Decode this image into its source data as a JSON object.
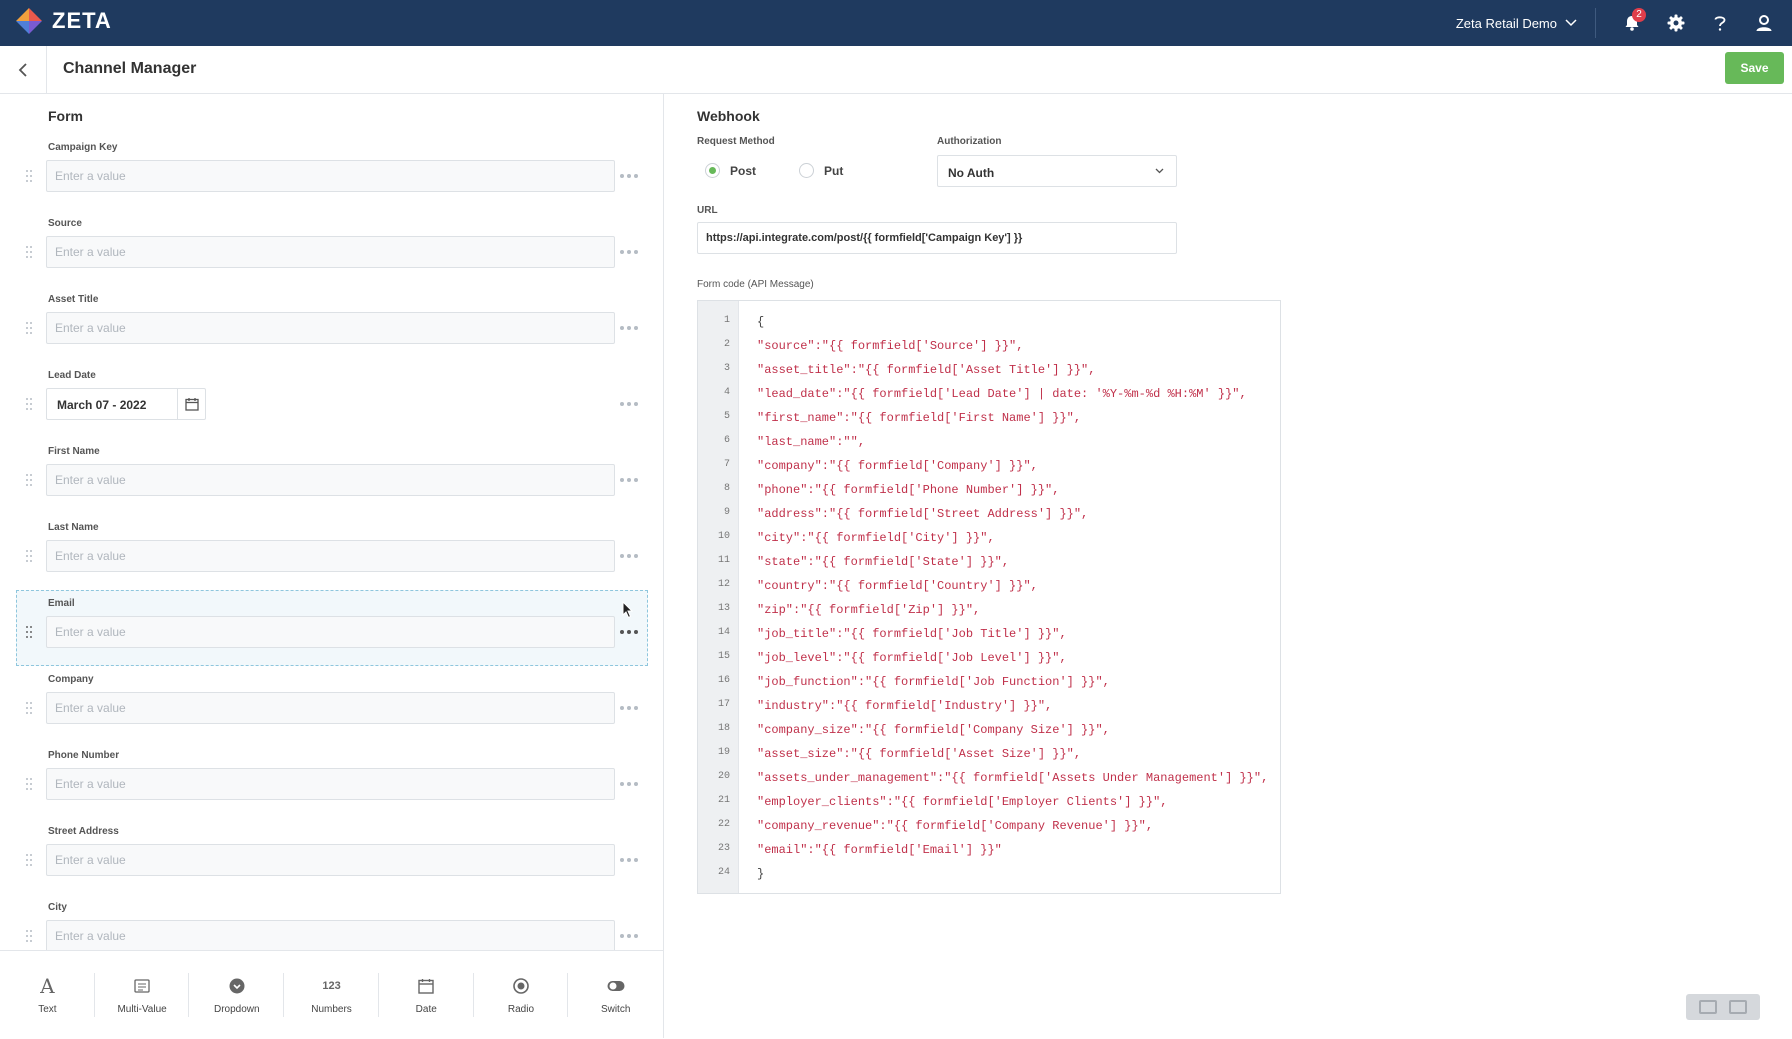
{
  "app": {
    "brand": "ZETA",
    "account": "Zeta Retail Demo",
    "notifications": "2"
  },
  "header": {
    "title": "Channel Manager",
    "save_label": "Save"
  },
  "form": {
    "title": "Form",
    "placeholder": "Enter a value",
    "fields": [
      {
        "label": "Campaign Key"
      },
      {
        "label": "Source"
      },
      {
        "label": "Asset Title"
      },
      {
        "label": "Lead Date",
        "value": "March 07 - 2022"
      },
      {
        "label": "First Name"
      },
      {
        "label": "Last Name"
      },
      {
        "label": "Email"
      },
      {
        "label": "Company"
      },
      {
        "label": "Phone Number"
      },
      {
        "label": "Street Address"
      },
      {
        "label": "City"
      }
    ]
  },
  "toolbox": [
    {
      "label": "Text",
      "icon": "text-icon"
    },
    {
      "label": "Multi-Value",
      "icon": "multi-value-icon"
    },
    {
      "label": "Dropdown",
      "icon": "dropdown-icon"
    },
    {
      "label": "Numbers",
      "icon": "numbers-icon",
      "glyph": "123"
    },
    {
      "label": "Date",
      "icon": "calendar-icon"
    },
    {
      "label": "Radio",
      "icon": "radio-icon"
    },
    {
      "label": "Switch",
      "icon": "switch-icon"
    }
  ],
  "webhook": {
    "title": "Webhook",
    "request_method_label": "Request Method",
    "methods": [
      "Post",
      "Put"
    ],
    "selected_method": "Post",
    "authorization_label": "Authorization",
    "authorization_value": "No Auth",
    "url_label": "URL",
    "url_value": "https://api.integrate.com/post/{{ formfield['Campaign Key'] }}",
    "code_label": "Form code (API Message)",
    "code_lines": [
      "{",
      "\"source\":\"{{ formfield['Source'] }}\",",
      "\"asset_title\":\"{{ formfield['Asset Title'] }}\",",
      "\"lead_date\":\"{{ formfield['Lead Date'] | date: '%Y-%m-%d %H:%M' }}\",",
      "\"first_name\":\"{{ formfield['First Name'] }}\",",
      "\"last_name\":\"\",",
      "\"company\":\"{{ formfield['Company'] }}\",",
      "\"phone\":\"{{ formfield['Phone Number'] }}\",",
      "\"address\":\"{{ formfield['Street Address'] }}\",",
      "\"city\":\"{{ formfield['City'] }}\",",
      "\"state\":\"{{ formfield['State'] }}\",",
      "\"country\":\"{{ formfield['Country'] }}\",",
      "\"zip\":\"{{ formfield['Zip'] }}\",",
      "\"job_title\":\"{{ formfield['Job Title'] }}\",",
      "\"job_level\":\"{{ formfield['Job Level'] }}\",",
      "\"job_function\":\"{{ formfield['Job Function'] }}\",",
      "\"industry\":\"{{ formfield['Industry'] }}\",",
      "\"company_size\":\"{{ formfield['Company Size'] }}\",",
      "\"asset_size\":\"{{ formfield['Asset Size'] }}\",",
      "\"assets_under_management\":\"{{ formfield['Assets Under Management'] }}\",",
      "\"employer_clients\":\"{{ formfield['Employer Clients'] }}\",",
      "\"company_revenue\":\"{{ formfield['Company Revenue'] }}\",",
      "\"email\":\"{{ formfield['Email'] }}\"",
      "}"
    ]
  },
  "colors": {
    "navbar": "#1f3a5f",
    "save": "#67b959",
    "code_string": "#c0304a",
    "selected_border": "#8ec6dd"
  }
}
